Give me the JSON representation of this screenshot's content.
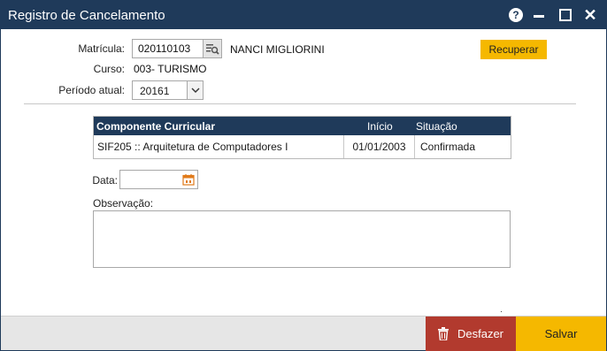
{
  "window": {
    "title": "Registro de Cancelamento"
  },
  "titlebar_icons": [
    "help-icon",
    "minimize-icon",
    "maximize-icon",
    "close-icon"
  ],
  "form": {
    "matricula_label": "Matrícula:",
    "matricula_value": "020110103",
    "student_name": "NANCI MIGLIORINI",
    "curso_label": "Curso:",
    "curso_value": "003- TURISMO",
    "periodo_label": "Período atual:",
    "periodo_value": "20161",
    "recuperar_label": "Recuperar"
  },
  "table": {
    "headers": {
      "componente": "Componente Curricular",
      "inicio": "Início",
      "situacao": "Situação"
    },
    "rows": [
      {
        "componente": "SIF205 :: Arquitetura de Computadores I",
        "inicio": "01/01/2003",
        "situacao": "Confirmada"
      }
    ]
  },
  "data_label": "Data:",
  "data_value": "",
  "observacao_label": "Observação:",
  "observacao_value": "",
  "footer": {
    "desfazer_label": "Desfazer",
    "salvar_label": "Salvar"
  },
  "colors": {
    "titlebar": "#1f3a5a",
    "accent_yellow": "#f5b800",
    "danger": "#b23a2e"
  }
}
